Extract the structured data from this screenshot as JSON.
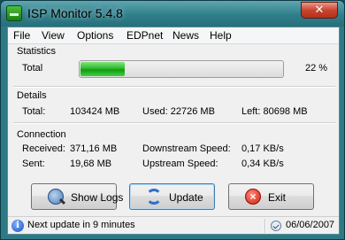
{
  "window": {
    "title": "ISP Monitor 5.4.8",
    "close_glyph": "✕"
  },
  "menu": [
    "File",
    "View",
    "Options",
    "EDPnet",
    "News",
    "Help"
  ],
  "statistics": {
    "group_label": "Statistics",
    "total_label": "Total",
    "percent_text": "22 %",
    "usage_fraction": 0.22
  },
  "details": {
    "group_label": "Details",
    "total": "Total:",
    "total_value": "103424 MB",
    "used": "Used: 22726 MB",
    "left": "Left: 80698 MB"
  },
  "connection": {
    "group_label": "Connection",
    "received_label": "Received:",
    "received_value": "371,16 MB",
    "sent_label": "Sent:",
    "sent_value": "19,68 MB",
    "downstream_label": "Downstream Speed:",
    "downstream_value": "0,17 KB/s",
    "upstream_label": "Upstream Speed:",
    "upstream_value": "0,34 KB/s"
  },
  "buttons": {
    "show_logs": "Show Logs",
    "update": "Update",
    "exit": "Exit"
  },
  "status": {
    "message": "Next update in 9 minutes",
    "date": "06/06/2007"
  },
  "icons": {
    "app": "app-icon",
    "info": "info-icon",
    "calendar": "calendar-icon"
  },
  "colors": {
    "progress_green": "#2bbd2b",
    "titlebar": "#2f7f8a",
    "close_red": "#c8452f"
  }
}
